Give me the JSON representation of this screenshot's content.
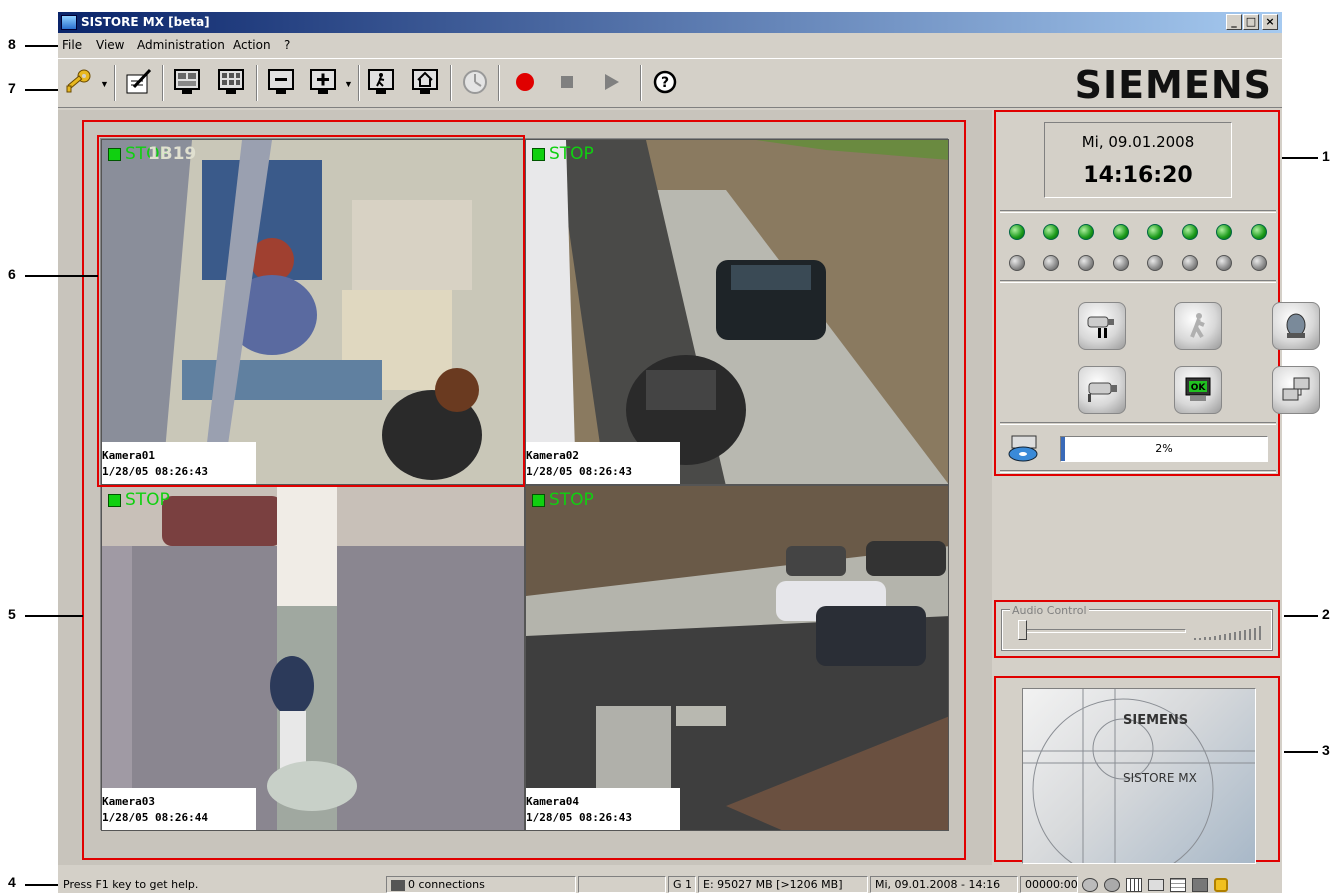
{
  "window": {
    "title": "SISTORE MX [beta]"
  },
  "menu": [
    "File",
    "View",
    "Administration",
    "Action",
    "?"
  ],
  "toolbar": {
    "items": [
      "key-icon",
      "edit-icon",
      "monitor-layout-icon",
      "monitor-grid-icon",
      "zoom-out-icon",
      "zoom-in-icon",
      "person-monitor-icon",
      "home-monitor-icon",
      "clock-icon",
      "record-icon",
      "stop-icon",
      "play-icon",
      "help-icon"
    ],
    "brand": "SIEMENS",
    "colors": {
      "record": "#e00000",
      "disabled": "#808080"
    }
  },
  "cameras": [
    {
      "name": "Kamera01",
      "timestamp": "1/28/05 08:26:43",
      "status": "STOP",
      "overlay": "1B19"
    },
    {
      "name": "Kamera02",
      "timestamp": "1/28/05 08:26:43",
      "status": "STOP"
    },
    {
      "name": "Kamera03",
      "timestamp": "1/28/05 08:26:44",
      "status": "STOP"
    },
    {
      "name": "Kamera04",
      "timestamp": "1/28/05 08:26:43",
      "status": "STOP"
    }
  ],
  "panel": {
    "date": "Mi, 09.01.2008",
    "time": "14:16:20",
    "leds_row1": [
      "green",
      "green",
      "green",
      "green",
      "green",
      "green",
      "green",
      "green"
    ],
    "leds_row2": [
      "gray",
      "gray",
      "gray",
      "gray",
      "gray",
      "gray",
      "gray",
      "gray"
    ],
    "buttons": [
      "camera-pause-icon",
      "walking-person-icon",
      "alarm-light-icon",
      "camera-icon",
      "ok-monitor-icon",
      "network-icon"
    ],
    "disk_usage_label": "2%",
    "disk_usage_fraction": 0.02,
    "audio_label": "Audio Control",
    "audio_level": 0,
    "splash_brand": "SIEMENS",
    "splash_product": "SISTORE MX"
  },
  "statusbar": {
    "help": "Press F1 key to get help.",
    "connections": "0 connections",
    "empty": "",
    "group": "G 1",
    "storage": "E: 95027 MB [>1206 MB]",
    "datetime": "Mi, 09.01.2008 - 14:16",
    "counter": "00000:00"
  },
  "callouts": [
    "1",
    "2",
    "3",
    "4",
    "5",
    "6",
    "7",
    "8"
  ]
}
